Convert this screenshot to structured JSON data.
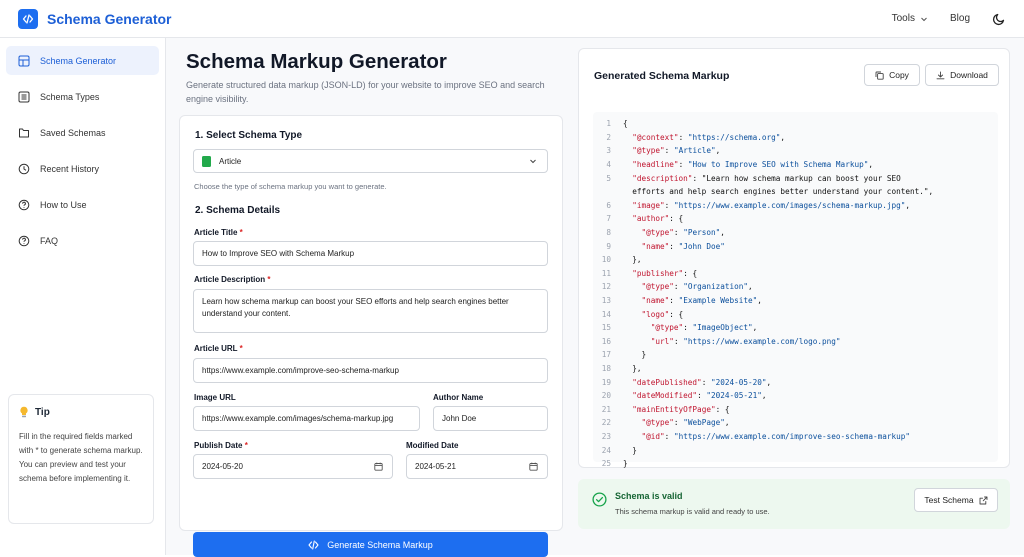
{
  "header": {
    "brand": "Schema Generator",
    "tools_label": "Tools",
    "blog_label": "Blog"
  },
  "sidebar": {
    "items": [
      {
        "label": "Schema Generator",
        "icon": "grid-icon",
        "active": true
      },
      {
        "label": "Schema Types",
        "icon": "list-icon"
      },
      {
        "label": "Saved Schemas",
        "icon": "folder-icon"
      },
      {
        "label": "Recent History",
        "icon": "clock-icon"
      },
      {
        "label": "How to Use",
        "icon": "help-circle-icon"
      },
      {
        "label": "FAQ",
        "icon": "help-circle-icon"
      }
    ],
    "tip": {
      "title": "Tip",
      "text": "Fill in the required fields marked with * to generate schema markup. You can preview and test your schema before implementing it."
    }
  },
  "main": {
    "title": "Schema Markup Generator",
    "subtitle": "Generate structured data markup (JSON-LD) for your website to improve SEO and search engine visibility.",
    "section1": "1. Select Schema Type",
    "schema_type": "Article",
    "schema_help": "Choose the type of schema markup you want to generate.",
    "section2": "2. Schema Details",
    "fields": {
      "title_label": "Article Title",
      "title_value": "How to Improve SEO with Schema Markup",
      "desc_label": "Article Description",
      "desc_value": "Learn how schema markup can boost your SEO efforts and help search engines better understand your content.",
      "url_label": "Article URL",
      "url_value": "https://www.example.com/improve-seo-schema-markup",
      "image_label": "Image URL",
      "image_value": "https://www.example.com/images/schema-markup.jpg",
      "author_label": "Author Name",
      "author_value": "John Doe",
      "publish_label": "Publish Date",
      "publish_value": "2024-05-20",
      "modified_label": "Modified Date",
      "modified_value": "2024-05-21"
    },
    "generate_label": "Generate Schema Markup"
  },
  "output": {
    "title": "Generated Schema Markup",
    "copy_label": "Copy",
    "download_label": "Download",
    "lines": [
      {
        "n": "1",
        "t": "{"
      },
      {
        "n": "2",
        "t": "  \"@context\": \"https://schema.org\","
      },
      {
        "n": "3",
        "t": "  \"@type\": \"Article\","
      },
      {
        "n": "4",
        "t": "  \"headline\": \"How to Improve SEO with Schema Markup\","
      },
      {
        "n": "5",
        "t": "  \"description\": \"Learn how schema markup can boost your SEO"
      },
      {
        "n": "",
        "t": "  efforts and help search engines better understand your content.\","
      },
      {
        "n": "6",
        "t": "  \"image\": \"https://www.example.com/images/schema-markup.jpg\","
      },
      {
        "n": "7",
        "t": "  \"author\": {"
      },
      {
        "n": "8",
        "t": "    \"@type\": \"Person\","
      },
      {
        "n": "9",
        "t": "    \"name\": \"John Doe\""
      },
      {
        "n": "10",
        "t": "  },"
      },
      {
        "n": "11",
        "t": "  \"publisher\": {"
      },
      {
        "n": "12",
        "t": "    \"@type\": \"Organization\","
      },
      {
        "n": "13",
        "t": "    \"name\": \"Example Website\","
      },
      {
        "n": "14",
        "t": "    \"logo\": {"
      },
      {
        "n": "15",
        "t": "      \"@type\": \"ImageObject\","
      },
      {
        "n": "16",
        "t": "      \"url\": \"https://www.example.com/logo.png\""
      },
      {
        "n": "17",
        "t": "    }"
      },
      {
        "n": "18",
        "t": "  },"
      },
      {
        "n": "19",
        "t": "  \"datePublished\": \"2024-05-20\","
      },
      {
        "n": "20",
        "t": "  \"dateModified\": \"2024-05-21\","
      },
      {
        "n": "21",
        "t": "  \"mainEntityOfPage\": {"
      },
      {
        "n": "22",
        "t": "    \"@type\": \"WebPage\","
      },
      {
        "n": "23",
        "t": "    \"@id\": \"https://www.example.com/improve-seo-schema-markup\""
      },
      {
        "n": "24",
        "t": "  }"
      },
      {
        "n": "25",
        "t": "}"
      }
    ],
    "valid_title": "Schema is valid",
    "valid_sub": "This schema markup is valid and ready to use.",
    "test_label": "Test Schema"
  },
  "colors": {
    "accent": "#1d6ef0",
    "valid_bg": "#edf8ef",
    "valid_text": "#166534"
  }
}
